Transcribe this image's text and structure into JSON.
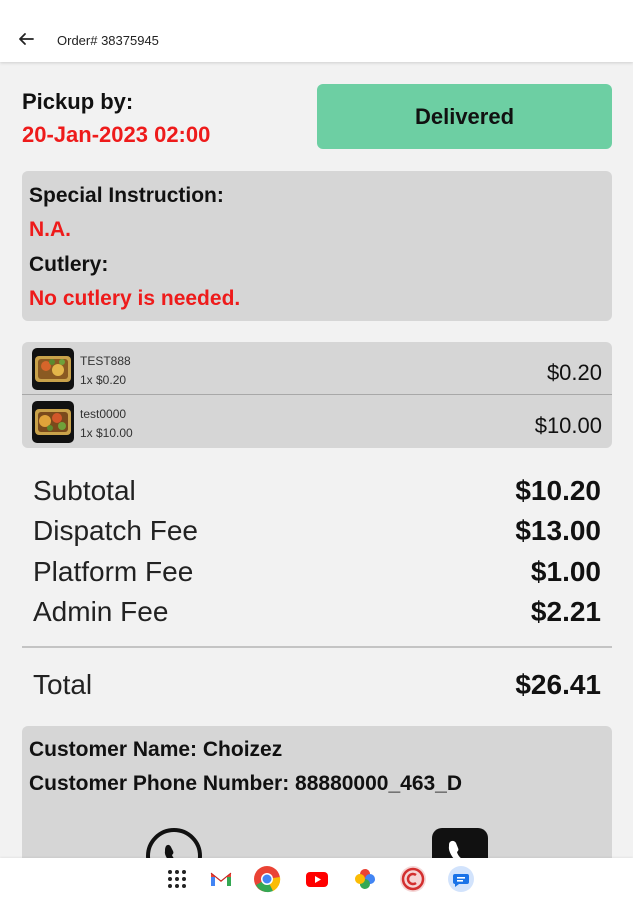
{
  "header": {
    "title": "Order# 38375945"
  },
  "pickup": {
    "label": "Pickup by:",
    "time": "20-Jan-2023 02:00"
  },
  "status": {
    "label": "Delivered",
    "color": "#6dcfa3"
  },
  "instructions": {
    "special_label": "Special Instruction:",
    "special_value": "N.A.",
    "cutlery_label": "Cutlery:",
    "cutlery_value": "No cutlery is needed."
  },
  "items": [
    {
      "name": "TEST888",
      "qty": "1x $0.20",
      "price": "$0.20"
    },
    {
      "name": "test0000",
      "qty": "1x $10.00",
      "price": "$10.00"
    }
  ],
  "fees": [
    {
      "label": "Subtotal",
      "value": "$10.20"
    },
    {
      "label": "Dispatch Fee",
      "value": "$13.00"
    },
    {
      "label": "Platform Fee",
      "value": "$1.00"
    },
    {
      "label": "Admin Fee",
      "value": "$2.21"
    }
  ],
  "total": {
    "label": "Total",
    "value": "$26.41"
  },
  "customer": {
    "name_line": "Customer Name: Choizez",
    "phone_line": "Customer Phone Number: 88880000_463_D"
  },
  "icons": {
    "back": "arrow-left-icon",
    "whatsapp": "whatsapp-icon",
    "phone": "phone-icon",
    "nav": [
      "app-grid-icon",
      "gmail-icon",
      "chrome-icon",
      "youtube-icon",
      "photos-icon",
      "app-icon",
      "messages-icon"
    ]
  },
  "colors": {
    "accent_red": "#ee1b1b",
    "status_green": "#6dcfa3",
    "card_gray": "#d6d6d6"
  }
}
